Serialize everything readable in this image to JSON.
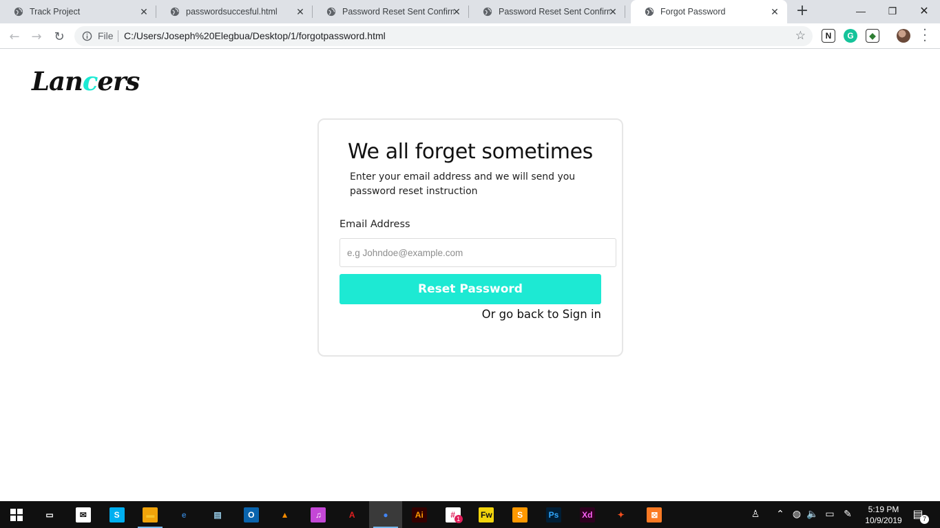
{
  "browser": {
    "tabs": [
      {
        "title": "Track Project",
        "active": false
      },
      {
        "title": "passwordsuccesful.html",
        "active": false
      },
      {
        "title": "Password Reset Sent Confirmat",
        "active": false
      },
      {
        "title": "Password Reset Sent Confirmat",
        "active": false
      },
      {
        "title": "Forgot Password",
        "active": true
      }
    ],
    "tab_close_glyph": "✕",
    "new_tab_glyph": "+",
    "window_controls": {
      "minimize": "—",
      "restore": "❐",
      "close": "✕"
    },
    "omnibox": {
      "scheme_label": "File",
      "url": "C:/Users/Joseph%20Elegbua/Desktop/1/forgotpassword.html"
    },
    "nav": {
      "back": "←",
      "forward": "→",
      "reload": "↻"
    },
    "extensions": [
      {
        "name": "notion-icon",
        "glyph": "N",
        "color": "#1a1a1a",
        "bg": "#ffffff"
      },
      {
        "name": "grammarly-icon",
        "glyph": "G",
        "color": "#ffffff",
        "bg": "#15c39a"
      },
      {
        "name": "extension-globe-icon",
        "glyph": "◆",
        "color": "#2e7d32",
        "bg": "#ffffff"
      }
    ]
  },
  "page": {
    "logo": {
      "part1": "Lan",
      "accent": "c",
      "part2": "ers"
    },
    "card": {
      "title": "We all forget sometimes",
      "subtitle": "Enter your email address and we will send you password reset instruction",
      "email_label": "Email Address",
      "email_placeholder": "e.g Johndoe@example.com",
      "email_value": "",
      "reset_button": "Reset Password",
      "signin_link": "Or go back to Sign in"
    },
    "colors": {
      "accent": "#1de9d3",
      "card_border": "#e6e6e6"
    }
  },
  "taskbar": {
    "apps": [
      {
        "name": "task-view-icon",
        "glyph": "▭",
        "fg": "#ffffff",
        "bg": "transparent"
      },
      {
        "name": "mail-icon",
        "glyph": "✉",
        "fg": "#101010",
        "bg": "#ffffff"
      },
      {
        "name": "skype-icon",
        "glyph": "S",
        "fg": "#ffffff",
        "bg": "#00aff0"
      },
      {
        "name": "file-explorer-icon",
        "glyph": "▬",
        "fg": "#f8c32c",
        "bg": "#f0a30a"
      },
      {
        "name": "edge-icon",
        "glyph": "e",
        "fg": "#3277bc",
        "bg": "transparent"
      },
      {
        "name": "notepad-icon",
        "glyph": "▤",
        "fg": "#9ad0ec",
        "bg": "transparent"
      },
      {
        "name": "outlook-icon",
        "glyph": "O",
        "fg": "#ffffff",
        "bg": "#0a64ad"
      },
      {
        "name": "vlc-icon",
        "glyph": "▲",
        "fg": "#f48b00",
        "bg": "transparent"
      },
      {
        "name": "itunes-icon",
        "glyph": "♫",
        "fg": "#ffffff",
        "bg": "#c447d6"
      },
      {
        "name": "acrobat-icon",
        "glyph": "A",
        "fg": "#e02020",
        "bg": "transparent"
      },
      {
        "name": "chrome-icon",
        "glyph": "●",
        "fg": "#4285f4",
        "bg": "transparent"
      },
      {
        "name": "illustrator-icon",
        "glyph": "Ai",
        "fg": "#ff9a00",
        "bg": "#330000"
      },
      {
        "name": "slack-icon",
        "glyph": "#",
        "fg": "#e01e5a",
        "bg": "#ffffff"
      },
      {
        "name": "fireworks-icon",
        "glyph": "Fw",
        "fg": "#101010",
        "bg": "#f2d40c"
      },
      {
        "name": "sublime-icon",
        "glyph": "S",
        "fg": "#ffffff",
        "bg": "#ff9800"
      },
      {
        "name": "photoshop-icon",
        "glyph": "Ps",
        "fg": "#31a8ff",
        "bg": "#001e36"
      },
      {
        "name": "xd-icon",
        "glyph": "Xd",
        "fg": "#ff61f6",
        "bg": "#2e001f"
      },
      {
        "name": "figma-icon",
        "glyph": "✦",
        "fg": "#f24e1e",
        "bg": "transparent"
      },
      {
        "name": "xampp-icon",
        "glyph": "⊠",
        "fg": "#ffffff",
        "bg": "#fb7a24"
      }
    ],
    "slack_badge": "1",
    "clock": {
      "time": "5:19 PM",
      "date": "10/9/2019"
    },
    "notification_count": "7"
  }
}
